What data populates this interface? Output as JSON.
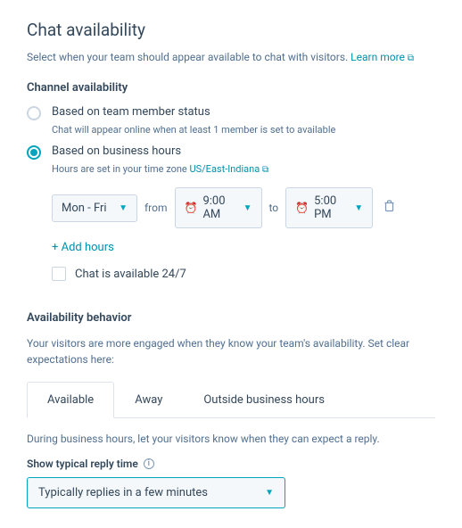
{
  "title": "Chat availability",
  "intro": "Select when your team should appear available to chat with visitors.",
  "learn_more": "Learn more",
  "channel": {
    "heading": "Channel availability",
    "opt1_label": "Based on team member status",
    "opt1_hint": "Chat will appear online when at least 1 member is set to available",
    "opt2_label": "Based on business hours",
    "opt2_hint_prefix": "Hours are set in your time zone ",
    "tz": "US/East-Indiana",
    "days": "Mon - Fri",
    "from": "from",
    "start": "9:00 AM",
    "to": "to",
    "end": "5:00 PM",
    "add_hours": "+ Add hours",
    "all_day": "Chat is available 24/7"
  },
  "behavior": {
    "heading": "Availability behavior",
    "desc": "Your visitors are more engaged when they know your team's availability. Set clear expectations here:",
    "tabs": {
      "t1": "Available",
      "t2": "Away",
      "t3": "Outside business hours"
    },
    "tab_desc": "During business hours, let your visitors know when they can expect a reply.",
    "reply_label": "Show typical reply time",
    "reply_value": "Typically replies in a few minutes"
  }
}
